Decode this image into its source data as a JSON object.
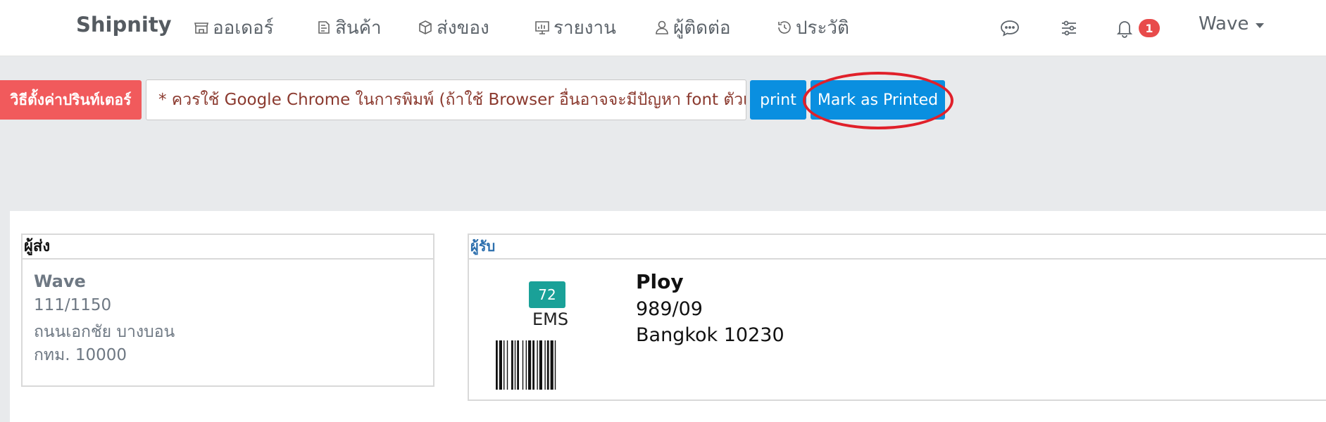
{
  "navbar": {
    "brand": "Shipnity",
    "items": [
      {
        "label": "ออเดอร์",
        "icon": "store-icon"
      },
      {
        "label": "สินค้า",
        "icon": "product-tag-icon"
      },
      {
        "label": "ส่งของ",
        "icon": "package-box-icon"
      },
      {
        "label": "รายงาน",
        "icon": "report-chart-icon"
      },
      {
        "label": "ผู้ติดต่อ",
        "icon": "user-icon"
      },
      {
        "label": "ประวัติ",
        "icon": "history-clock-icon"
      }
    ],
    "notification_count": "1",
    "user_name": "Wave"
  },
  "toolbar": {
    "printer_setup_label": "วิธีตั้งค่าปรินท์เตอร์",
    "chrome_notice": "* ควรใช้ Google Chrome ในการพิมพ์ (ถ้าใช้ Browser อื่นอาจจะมีปัญหา font ตัวเล็ก)",
    "print_label": "print",
    "mark_printed_label": "Mark as Printed"
  },
  "colors": {
    "danger": "#f15a5c",
    "primary": "#0a8fe0",
    "badge_teal": "#1aa198",
    "highlight": "#e0202a"
  },
  "label": {
    "sender": {
      "heading": "ผู้ส่ง",
      "name": "Wave",
      "address_line1": "111/1150",
      "address_line2": "ถนนเอกชัย บางบอน",
      "address_line3": "กทม. 10000"
    },
    "recipient": {
      "heading": "ผู้รับ",
      "count_badge": "72",
      "carrier": "EMS",
      "name": "Ploy",
      "address_line1": "989/09",
      "address_line2": "Bangkok 10230"
    }
  }
}
